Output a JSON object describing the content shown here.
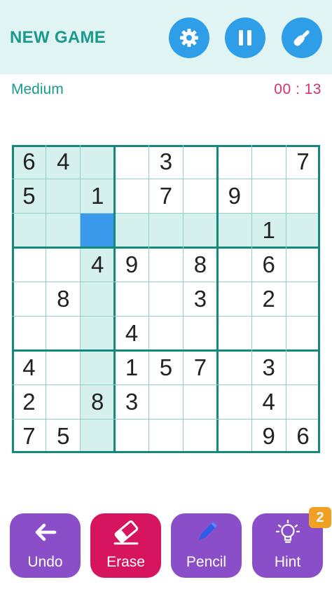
{
  "header": {
    "new_game_label": "NEW GAME"
  },
  "status": {
    "difficulty": "Medium",
    "timer": "00 : 13"
  },
  "colors": {
    "header_bg": "#dff4f3",
    "accent_teal": "#1a9a8c",
    "timer_pink": "#d6336c",
    "round_button_blue": "#2f9ee9",
    "highlight": "#d6f0ee",
    "selected_cell": "#3a99ea",
    "undo_purple": "#8a4fc8",
    "erase_crimson": "#d6155e",
    "pencil_purple": "#8a4fc8",
    "hint_purple": "#8a4fc8",
    "badge_orange": "#f0a022"
  },
  "header_icons": [
    "gear-icon",
    "pause-icon",
    "paintbrush-icon"
  ],
  "board": {
    "rows": [
      [
        "6",
        "4",
        "",
        "",
        "3",
        "",
        "",
        "",
        "7"
      ],
      [
        "5",
        "",
        "1",
        "",
        "7",
        "",
        "9",
        "",
        ""
      ],
      [
        "",
        "",
        "",
        "",
        "",
        "",
        "",
        "1",
        ""
      ],
      [
        "",
        "",
        "4",
        "9",
        "",
        "8",
        "",
        "6",
        ""
      ],
      [
        "",
        "8",
        "",
        "",
        "",
        "3",
        "",
        "2",
        ""
      ],
      [
        "",
        "",
        "",
        "4",
        "",
        "",
        "",
        "",
        ""
      ],
      [
        "4",
        "",
        "",
        "1",
        "5",
        "7",
        "",
        "3",
        ""
      ],
      [
        "2",
        "",
        "8",
        "3",
        "",
        "",
        "",
        "4",
        ""
      ],
      [
        "7",
        "5",
        "",
        "",
        "",
        "",
        "",
        "9",
        "6"
      ]
    ],
    "selected": {
      "row": 2,
      "col": 2
    }
  },
  "buttons": {
    "undo": {
      "label": "Undo",
      "icon": "arrow-left-icon"
    },
    "erase": {
      "label": "Erase",
      "icon": "eraser-icon"
    },
    "pencil": {
      "label": "Pencil",
      "icon": "pencil-icon"
    },
    "hint": {
      "label": "Hint",
      "icon": "lightbulb-icon",
      "badge": "2"
    }
  }
}
